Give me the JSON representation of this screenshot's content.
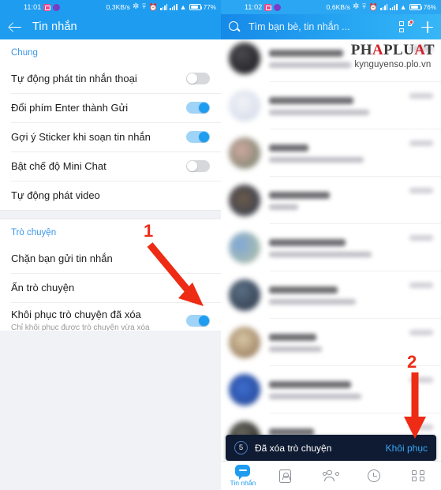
{
  "left": {
    "statusbar": {
      "clock": "11:01",
      "data_rate": "0,3KB/s",
      "battery": "77%",
      "icons": [
        "camera-badge-icon",
        "purple-dot-icon",
        "bluetooth-icon",
        "vibrate-off-icon",
        "alarm-icon",
        "signal-1-icon",
        "signal-2-icon",
        "wifi-icon",
        "battery-icon"
      ]
    },
    "appbar": {
      "title": "Tin nhắn",
      "back": "back-arrow-icon"
    },
    "sections": [
      {
        "header": "Chung",
        "rows": [
          {
            "label": "Tự động phát tin nhắn thoại",
            "sub": "",
            "toggle": "off"
          },
          {
            "label": "Đổi phím Enter thành Gửi",
            "sub": "",
            "toggle": "on"
          },
          {
            "label": "Gợi ý Sticker khi soạn tin nhắn",
            "sub": "",
            "toggle": "on"
          },
          {
            "label": "Bật chế độ Mini Chat",
            "sub": "",
            "toggle": "off"
          },
          {
            "label": "Tự động phát video",
            "sub": "",
            "toggle": "none"
          }
        ]
      },
      {
        "header": "Trò chuyện",
        "rows": [
          {
            "label": "Chặn bạn gửi tin nhắn",
            "sub": "",
            "toggle": "none"
          },
          {
            "label": "Ẩn trò chuyện",
            "sub": "",
            "toggle": "none"
          },
          {
            "label": "Khôi phục trò chuyện đã xóa",
            "sub": "Chỉ khôi phục được trò chuyện vừa xóa",
            "toggle": "on"
          }
        ]
      }
    ]
  },
  "right": {
    "statusbar": {
      "clock": "11:02",
      "data_rate": "0,6KB/s",
      "battery": "76%"
    },
    "searchbar": {
      "placeholder": "Tìm bạn bè, tin nhắn ...",
      "search_icon": "search-icon",
      "qr_icon": "qr-scan-icon",
      "add_icon": "plus-icon"
    },
    "chat_rows": [
      {
        "name_w": 56,
        "msg_w": 62,
        "has_time": true
      },
      {
        "name_w": 64,
        "msg_w": 76,
        "has_time": true
      },
      {
        "name_w": 30,
        "msg_w": 72,
        "has_time": true
      },
      {
        "name_w": 46,
        "msg_w": 22,
        "has_time": true
      },
      {
        "name_w": 58,
        "msg_w": 78,
        "has_time": true
      },
      {
        "name_w": 52,
        "msg_w": 66,
        "has_time": true
      },
      {
        "name_w": 36,
        "msg_w": 40,
        "has_time": true
      },
      {
        "name_w": 62,
        "msg_w": 70,
        "has_time": true
      },
      {
        "name_w": 34,
        "msg_w": 10,
        "has_time": true
      }
    ],
    "snackbar": {
      "countdown": "5",
      "message": "Đã xóa trò chuyện",
      "action": "Khôi phục"
    },
    "bottomnav": [
      {
        "label": "Tin nhắn",
        "icon": "messages-icon",
        "active": true
      },
      {
        "label": "",
        "icon": "contacts-card-icon",
        "active": false
      },
      {
        "label": "",
        "icon": "groups-icon",
        "active": false
      },
      {
        "label": "",
        "icon": "clock-icon",
        "active": false
      },
      {
        "label": "",
        "icon": "grid-more-icon",
        "active": false
      }
    ]
  },
  "watermark": {
    "logo_prefix": "PH",
    "logo_a1": "A",
    "logo_mid": "PLU",
    "logo_a2": "A",
    "logo_suffix": "T",
    "url": "kynguyenso.plo.vn"
  },
  "annotations": [
    {
      "label": "1",
      "kind": "arrow-down-right"
    },
    {
      "label": "2",
      "kind": "arrow-down"
    }
  ],
  "colors": {
    "accent": "#1e9cf0",
    "annotation": "#ee2b14",
    "snackbar_bg": "#0f1b33",
    "panel_bg": "#f1f2f6"
  }
}
